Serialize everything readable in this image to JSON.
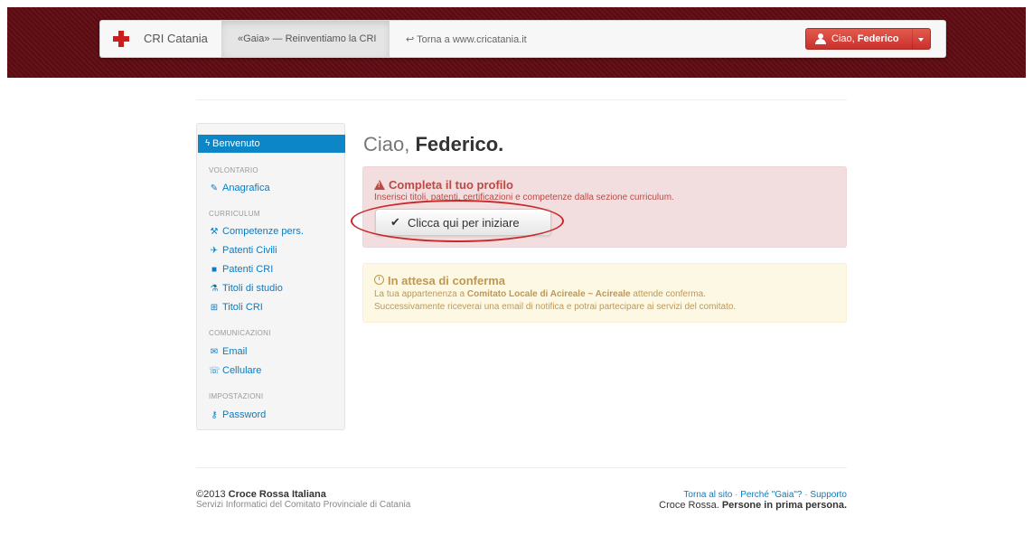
{
  "navbar": {
    "brand": "CRI Catania",
    "active_tab": "«Gaia» — Reinventiamo la CRI",
    "back_link": "Torna a www.cricatania.it",
    "user_greeting": "Ciao,",
    "user_name": "Federico"
  },
  "sidebar": {
    "active": "Benvenuto",
    "sections": [
      {
        "heading": "VOLONTARIO",
        "items": [
          "Anagrafica"
        ]
      },
      {
        "heading": "CURRICULUM",
        "items": [
          "Competenze pers.",
          "Patenti Civili",
          "Patenti CRI",
          "Titoli di studio",
          "Titoli CRI"
        ]
      },
      {
        "heading": "COMUNICAZIONI",
        "items": [
          "Email",
          "Cellulare"
        ]
      },
      {
        "heading": "IMPOSTAZIONI",
        "items": [
          "Password"
        ]
      }
    ]
  },
  "main": {
    "greeting": "Ciao,",
    "name": "Federico."
  },
  "alert_profile": {
    "title": "Completa il tuo profilo",
    "body": "Inserisci titoli, patenti, certificazioni e competenze dalla sezione curriculum.",
    "button": "Clicca qui per iniziare"
  },
  "alert_pending": {
    "title": "In attesa di conferma",
    "line1_prefix": "La tua appartenenza a",
    "line1_strong": "Comitato Locale di Acireale ~ Acireale",
    "line1_suffix": "attende conferma.",
    "line2": "Successivamente riceverai una email di notifica e potrai partecipare ai servizi del comitato."
  },
  "footer": {
    "copyright": "©2013",
    "org": "Croce Rossa Italiana",
    "sub": "Servizi Informatici del Comitato Provinciale di Catania",
    "links": [
      "Torna al sito",
      "Perché \"Gaia\"?",
      "Supporto"
    ],
    "tagline_prefix": "Croce Rossa.",
    "tagline_strong": "Persone in prima persona."
  },
  "colors": {
    "header_band": "#5e0a12",
    "primary": "#0d86c8",
    "danger": "#c9302c",
    "error_text": "#b94a48",
    "warning_text": "#c09853"
  }
}
